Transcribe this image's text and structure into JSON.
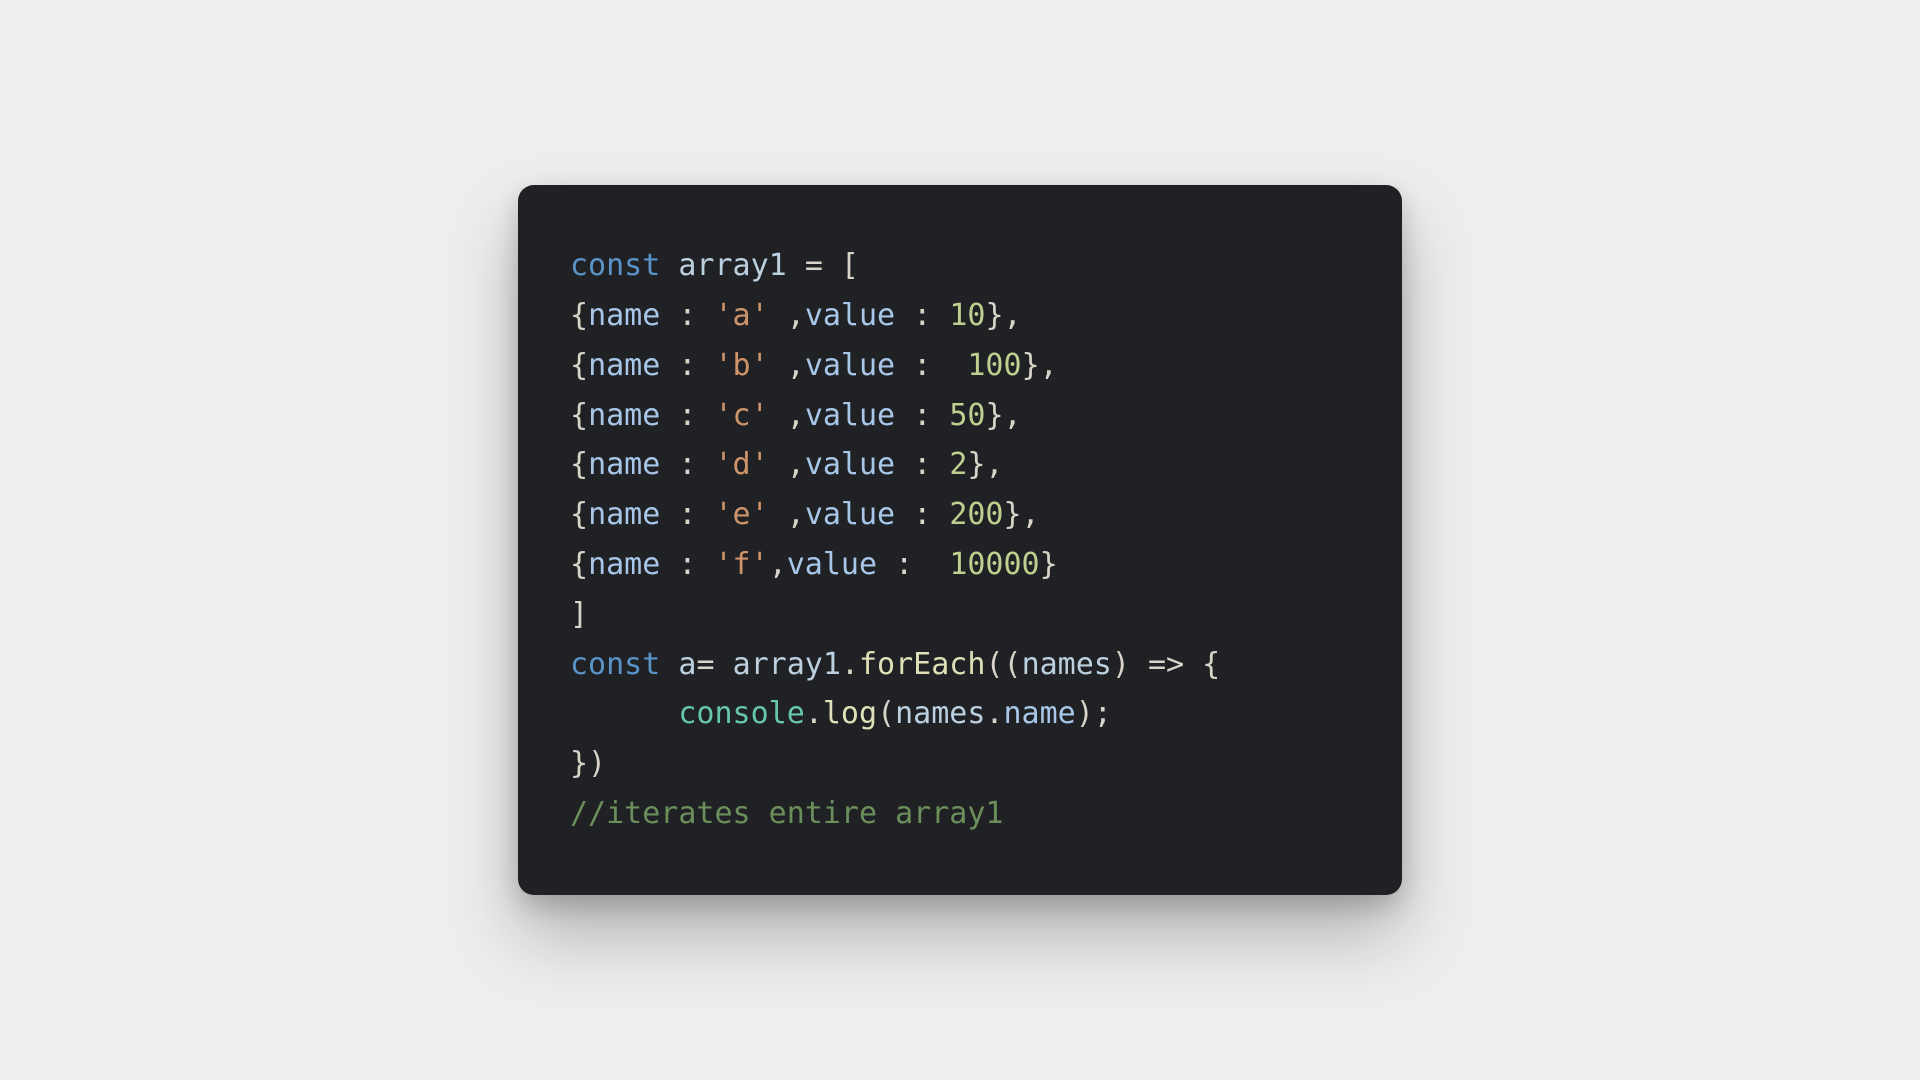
{
  "colors": {
    "page_bg": "#eeeeee",
    "card_bg": "#1f2124",
    "default": "#d8d4c8",
    "keyword": "#5a93c7",
    "variable": "#bcd0e0",
    "property": "#a8c6e8",
    "string": "#cf946a",
    "number": "#c0ce8f",
    "function": "#e0e0b8",
    "builtin_obj": "#66c6b0",
    "comment": "#6b8f5a"
  },
  "code": {
    "lines": [
      [
        {
          "t": "const ",
          "c": "tok-kw"
        },
        {
          "t": "array1",
          "c": "tok-var"
        },
        {
          "t": " ",
          "c": "tok-punc"
        },
        {
          "t": "=",
          "c": "tok-op"
        },
        {
          "t": " [",
          "c": "tok-punc"
        }
      ],
      [
        {
          "t": "{",
          "c": "tok-punc"
        },
        {
          "t": "name",
          "c": "tok-prop"
        },
        {
          "t": " ",
          "c": "tok-punc"
        },
        {
          "t": ":",
          "c": "tok-op"
        },
        {
          "t": " ",
          "c": "tok-punc"
        },
        {
          "t": "'a'",
          "c": "tok-str"
        },
        {
          "t": " ,",
          "c": "tok-punc"
        },
        {
          "t": "value",
          "c": "tok-prop"
        },
        {
          "t": " ",
          "c": "tok-punc"
        },
        {
          "t": ":",
          "c": "tok-op"
        },
        {
          "t": " ",
          "c": "tok-punc"
        },
        {
          "t": "10",
          "c": "tok-num"
        },
        {
          "t": "},",
          "c": "tok-punc"
        }
      ],
      [
        {
          "t": "{",
          "c": "tok-punc"
        },
        {
          "t": "name",
          "c": "tok-prop"
        },
        {
          "t": " ",
          "c": "tok-punc"
        },
        {
          "t": ":",
          "c": "tok-op"
        },
        {
          "t": " ",
          "c": "tok-punc"
        },
        {
          "t": "'b'",
          "c": "tok-str"
        },
        {
          "t": " ,",
          "c": "tok-punc"
        },
        {
          "t": "value",
          "c": "tok-prop"
        },
        {
          "t": " ",
          "c": "tok-punc"
        },
        {
          "t": ":",
          "c": "tok-op"
        },
        {
          "t": "  ",
          "c": "tok-punc"
        },
        {
          "t": "100",
          "c": "tok-num"
        },
        {
          "t": "},",
          "c": "tok-punc"
        }
      ],
      [
        {
          "t": "{",
          "c": "tok-punc"
        },
        {
          "t": "name",
          "c": "tok-prop"
        },
        {
          "t": " ",
          "c": "tok-punc"
        },
        {
          "t": ":",
          "c": "tok-op"
        },
        {
          "t": " ",
          "c": "tok-punc"
        },
        {
          "t": "'c'",
          "c": "tok-str"
        },
        {
          "t": " ,",
          "c": "tok-punc"
        },
        {
          "t": "value",
          "c": "tok-prop"
        },
        {
          "t": " ",
          "c": "tok-punc"
        },
        {
          "t": ":",
          "c": "tok-op"
        },
        {
          "t": " ",
          "c": "tok-punc"
        },
        {
          "t": "50",
          "c": "tok-num"
        },
        {
          "t": "},",
          "c": "tok-punc"
        }
      ],
      [
        {
          "t": "{",
          "c": "tok-punc"
        },
        {
          "t": "name",
          "c": "tok-prop"
        },
        {
          "t": " ",
          "c": "tok-punc"
        },
        {
          "t": ":",
          "c": "tok-op"
        },
        {
          "t": " ",
          "c": "tok-punc"
        },
        {
          "t": "'d'",
          "c": "tok-str"
        },
        {
          "t": " ,",
          "c": "tok-punc"
        },
        {
          "t": "value",
          "c": "tok-prop"
        },
        {
          "t": " ",
          "c": "tok-punc"
        },
        {
          "t": ":",
          "c": "tok-op"
        },
        {
          "t": " ",
          "c": "tok-punc"
        },
        {
          "t": "2",
          "c": "tok-num"
        },
        {
          "t": "},",
          "c": "tok-punc"
        }
      ],
      [
        {
          "t": "{",
          "c": "tok-punc"
        },
        {
          "t": "name",
          "c": "tok-prop"
        },
        {
          "t": " ",
          "c": "tok-punc"
        },
        {
          "t": ":",
          "c": "tok-op"
        },
        {
          "t": " ",
          "c": "tok-punc"
        },
        {
          "t": "'e'",
          "c": "tok-str"
        },
        {
          "t": " ,",
          "c": "tok-punc"
        },
        {
          "t": "value",
          "c": "tok-prop"
        },
        {
          "t": " ",
          "c": "tok-punc"
        },
        {
          "t": ":",
          "c": "tok-op"
        },
        {
          "t": " ",
          "c": "tok-punc"
        },
        {
          "t": "200",
          "c": "tok-num"
        },
        {
          "t": "},",
          "c": "tok-punc"
        }
      ],
      [
        {
          "t": "{",
          "c": "tok-punc"
        },
        {
          "t": "name",
          "c": "tok-prop"
        },
        {
          "t": " ",
          "c": "tok-punc"
        },
        {
          "t": ":",
          "c": "tok-op"
        },
        {
          "t": " ",
          "c": "tok-punc"
        },
        {
          "t": "'f'",
          "c": "tok-str"
        },
        {
          "t": ",",
          "c": "tok-punc"
        },
        {
          "t": "value",
          "c": "tok-prop"
        },
        {
          "t": " ",
          "c": "tok-punc"
        },
        {
          "t": ":",
          "c": "tok-op"
        },
        {
          "t": "  ",
          "c": "tok-punc"
        },
        {
          "t": "10000",
          "c": "tok-num"
        },
        {
          "t": "}",
          "c": "tok-punc"
        }
      ],
      [
        {
          "t": "]",
          "c": "tok-punc"
        }
      ],
      [
        {
          "t": "const ",
          "c": "tok-kw"
        },
        {
          "t": "a",
          "c": "tok-var"
        },
        {
          "t": "= ",
          "c": "tok-op"
        },
        {
          "t": "array1",
          "c": "tok-var"
        },
        {
          "t": ".",
          "c": "tok-punc"
        },
        {
          "t": "forEach",
          "c": "tok-fn"
        },
        {
          "t": "((",
          "c": "tok-punc"
        },
        {
          "t": "names",
          "c": "tok-var"
        },
        {
          "t": ") ",
          "c": "tok-punc"
        },
        {
          "t": "=>",
          "c": "tok-op"
        },
        {
          "t": " {",
          "c": "tok-punc"
        }
      ],
      [
        {
          "t": "      ",
          "c": "tok-punc"
        },
        {
          "t": "console",
          "c": "tok-obj"
        },
        {
          "t": ".",
          "c": "tok-punc"
        },
        {
          "t": "log",
          "c": "tok-fn"
        },
        {
          "t": "(",
          "c": "tok-punc"
        },
        {
          "t": "names",
          "c": "tok-var"
        },
        {
          "t": ".",
          "c": "tok-punc"
        },
        {
          "t": "name",
          "c": "tok-prop"
        },
        {
          "t": ");",
          "c": "tok-punc"
        }
      ],
      [
        {
          "t": "})",
          "c": "tok-punc"
        }
      ],
      [
        {
          "t": "//iterates entire array1",
          "c": "tok-cmt"
        }
      ]
    ]
  }
}
